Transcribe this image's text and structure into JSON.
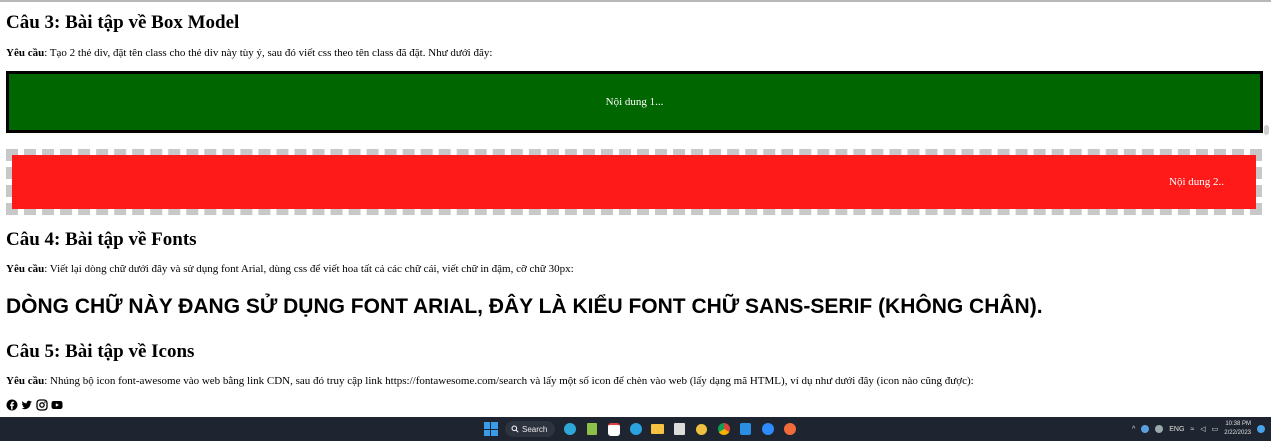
{
  "section3": {
    "heading": "Câu 3: Bài tập về Box Model",
    "req_label": "Yêu cầu",
    "req_text": ": Tạo 2 thẻ div, đặt tên class cho thẻ div này tùy ý, sau đó viết css theo tên class đã đặt. Như dưới đây:",
    "box1_text": "Nội dung 1...",
    "box2_text": "Nội dung 2..",
    "colors": {
      "box1": "#006600",
      "box2": "#ff1a1a",
      "box2_border": "#c8c8c8"
    }
  },
  "section4": {
    "heading": "Câu 4: Bài tập về Fonts",
    "req_label": "Yêu cầu",
    "req_text": ": Viết lại dòng chữ dưới đây và sử dụng font Arial, dùng css để viết hoa tất cả các chữ cái, viết chữ in đậm, cỡ chữ 30px:",
    "sample_text": "Dòng chữ này đang sử dụng font Arial, đây là kiểu font chữ sans-serif (không chân)."
  },
  "section5": {
    "heading": "Câu 5: Bài tập về Icons",
    "req_label": "Yêu cầu",
    "req_text": ": Nhúng bộ icon font-awesome vào web bằng link CDN, sau đó truy cập link https://fontawesome.com/search và lấy một số icon để chèn vào web (lấy dạng mã HTML), ví dụ như dưới đây (icon nào cũng được):",
    "icons": [
      "facebook-icon",
      "twitter-icon",
      "instagram-icon",
      "youtube-icon"
    ]
  },
  "taskbar": {
    "search_label": "Search",
    "language": "ENG",
    "time": "10:38 PM",
    "date": "2/22/2023",
    "apps": [
      "edge-icon",
      "notepad-icon",
      "chat-icon",
      "telegram-icon",
      "file-explorer-icon",
      "editor-icon",
      "snip-icon",
      "chrome-icon",
      "vscode-icon",
      "zoom-icon",
      "browser-icon"
    ]
  }
}
